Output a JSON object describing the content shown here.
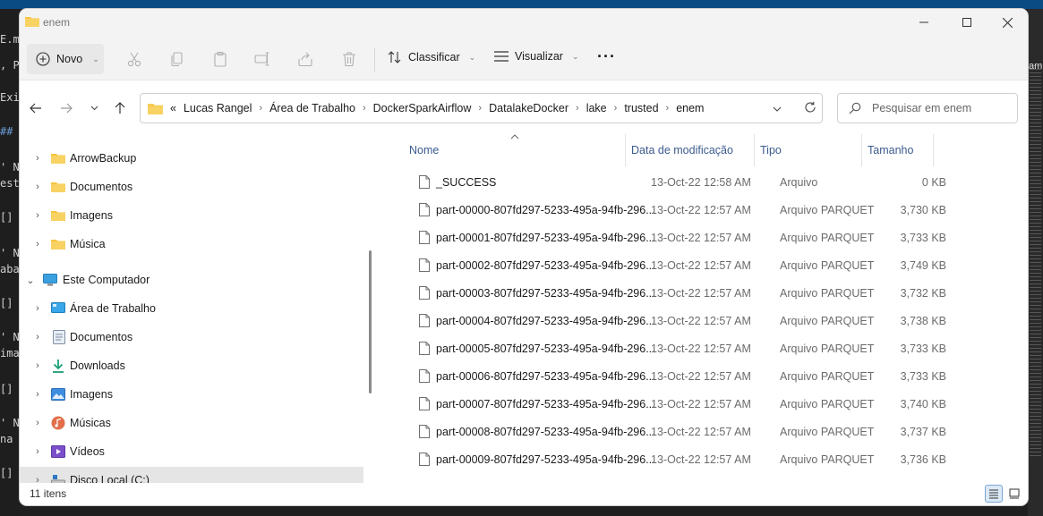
{
  "window": {
    "title": "enem",
    "minimize": "—",
    "maximize": "☐",
    "close": "✕"
  },
  "toolbar": {
    "new_label": "Novo",
    "sort_label": "Classificar",
    "view_label": "Visualizar",
    "more_label": "···"
  },
  "address": {
    "crumbs": [
      "«",
      "Lucas Rangel",
      "Área de Trabalho",
      "DockerSparkAirflow",
      "DatalakeDocker",
      "lake",
      "trusted",
      "enem"
    ]
  },
  "search": {
    "placeholder": "Pesquisar em enem"
  },
  "sidebar": {
    "items": [
      {
        "label": "ArrowBackup",
        "icon": "folder-icon"
      },
      {
        "label": "Documentos",
        "icon": "folder-icon"
      },
      {
        "label": "Imagens",
        "icon": "folder-icon"
      },
      {
        "label": "Música",
        "icon": "folder-icon"
      },
      {
        "label": "Este Computador",
        "icon": "computer-icon"
      },
      {
        "label": "Área de Trabalho",
        "icon": "desktop-icon"
      },
      {
        "label": "Documentos",
        "icon": "documents-icon"
      },
      {
        "label": "Downloads",
        "icon": "downloads-icon"
      },
      {
        "label": "Imagens",
        "icon": "pictures-icon"
      },
      {
        "label": "Músicas",
        "icon": "music-icon"
      },
      {
        "label": "Vídeos",
        "icon": "videos-icon"
      },
      {
        "label": "Disco Local (C:)",
        "icon": "drive-icon"
      }
    ]
  },
  "columns": {
    "name": "Nome",
    "modified": "Data de modificação",
    "type": "Tipo",
    "size": "Tamanho"
  },
  "files": [
    {
      "name": "_SUCCESS",
      "modified": "13-Oct-22 12:58 AM",
      "type": "Arquivo",
      "size": "0 KB"
    },
    {
      "name": "part-00000-807fd297-5233-495a-94fb-296...",
      "modified": "13-Oct-22 12:57 AM",
      "type": "Arquivo PARQUET",
      "size": "3,730 KB"
    },
    {
      "name": "part-00001-807fd297-5233-495a-94fb-296...",
      "modified": "13-Oct-22 12:57 AM",
      "type": "Arquivo PARQUET",
      "size": "3,733 KB"
    },
    {
      "name": "part-00002-807fd297-5233-495a-94fb-296...",
      "modified": "13-Oct-22 12:57 AM",
      "type": "Arquivo PARQUET",
      "size": "3,749 KB"
    },
    {
      "name": "part-00003-807fd297-5233-495a-94fb-296...",
      "modified": "13-Oct-22 12:57 AM",
      "type": "Arquivo PARQUET",
      "size": "3,732 KB"
    },
    {
      "name": "part-00004-807fd297-5233-495a-94fb-296...",
      "modified": "13-Oct-22 12:57 AM",
      "type": "Arquivo PARQUET",
      "size": "3,738 KB"
    },
    {
      "name": "part-00005-807fd297-5233-495a-94fb-296...",
      "modified": "13-Oct-22 12:57 AM",
      "type": "Arquivo PARQUET",
      "size": "3,733 KB"
    },
    {
      "name": "part-00006-807fd297-5233-495a-94fb-296...",
      "modified": "13-Oct-22 12:57 AM",
      "type": "Arquivo PARQUET",
      "size": "3,733 KB"
    },
    {
      "name": "part-00007-807fd297-5233-495a-94fb-296...",
      "modified": "13-Oct-22 12:57 AM",
      "type": "Arquivo PARQUET",
      "size": "3,740 KB"
    },
    {
      "name": "part-00008-807fd297-5233-495a-94fb-296...",
      "modified": "13-Oct-22 12:57 AM",
      "type": "Arquivo PARQUET",
      "size": "3,737 KB"
    },
    {
      "name": "part-00009-807fd297-5233-495a-94fb-296...",
      "modified": "13-Oct-22 12:57 AM",
      "type": "Arquivo PARQUET",
      "size": "3,736 KB"
    }
  ],
  "status": {
    "item_count": "11 itens"
  },
  "colors": {
    "folder": "#f5c53d",
    "header_text": "#3b5b8e",
    "accent": "#0067c0"
  }
}
